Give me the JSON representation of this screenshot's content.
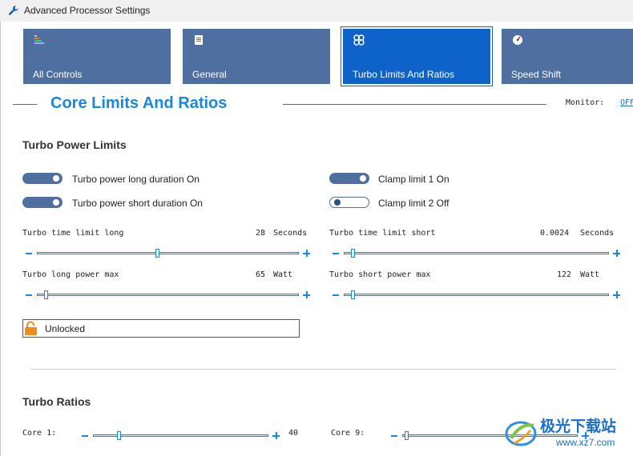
{
  "window": {
    "title": "Advanced Processor Settings"
  },
  "tabs": [
    {
      "label": "All Controls",
      "icon": "bars-icon",
      "active": false
    },
    {
      "label": "General",
      "icon": "document-icon",
      "active": false
    },
    {
      "label": "Turbo Limits And Ratios",
      "icon": "sliders-icon",
      "active": true
    },
    {
      "label": "Speed Shift",
      "icon": "gauge-icon",
      "active": false
    }
  ],
  "section": {
    "title": "Core Limits And Ratios"
  },
  "monitor": {
    "label": "Monitor:",
    "value": "OFF"
  },
  "turbo_power": {
    "heading": "Turbo Power Limits",
    "toggles": {
      "long_duration": {
        "label": "Turbo power long duration On",
        "on": true
      },
      "short_duration": {
        "label": "Turbo power short duration On",
        "on": true
      },
      "clamp1": {
        "label": "Clamp limit 1 On",
        "on": true
      },
      "clamp2": {
        "label": "Clamp limit 2 Off",
        "on": false
      }
    },
    "sliders": {
      "time_long": {
        "label": "Turbo time limit long",
        "value": "28",
        "unit": "Seconds",
        "position": 0.46
      },
      "time_short": {
        "label": "Turbo time limit short",
        "value": "0.0024",
        "unit": "Seconds",
        "position": 0.02
      },
      "long_power": {
        "label": "Turbo long power max",
        "value": "65",
        "unit": "Watt",
        "position": 0.02
      },
      "short_power": {
        "label": "Turbo short power max",
        "value": "122",
        "unit": "Watt",
        "position": 0.02
      }
    },
    "lock": {
      "label": "Unlocked",
      "icon": "padlock-icon"
    }
  },
  "turbo_ratios": {
    "heading": "Turbo Ratios",
    "cores": [
      {
        "label": "Core 1:",
        "value": "40",
        "position": 0.13
      },
      {
        "label": "Core 9:",
        "value": "",
        "position": 0.0
      }
    ]
  },
  "watermark": {
    "text": "极光下载站",
    "url": "www.xz7.com"
  },
  "colors": {
    "tab": "#4f6fa0",
    "tab_active": "#0d63c9",
    "accent": "#1a86e0"
  }
}
